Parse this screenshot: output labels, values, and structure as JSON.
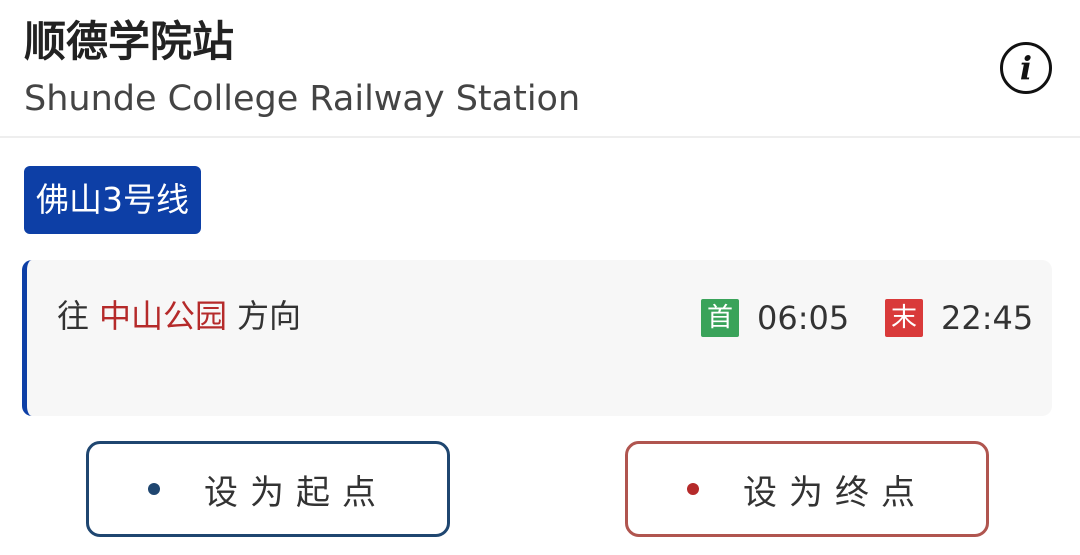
{
  "station": {
    "name_cn": "顺德学院站",
    "name_en": "Shunde College Railway Station",
    "info_icon": "i"
  },
  "line": {
    "name": "佛山3号线",
    "color": "#0d3fa6"
  },
  "direction": {
    "prefix": "往",
    "destination": "中山公园",
    "suffix": "方向",
    "first_tag": "首",
    "first_time": "06:05",
    "last_tag": "末",
    "last_time": "22:45"
  },
  "actions": {
    "set_start": "设为起点",
    "set_end": "设为终点"
  },
  "colors": {
    "accent_blue": "#0d3fa6",
    "destination_red": "#b52a2a",
    "first_green": "#3aa35a",
    "last_red": "#d93a3a"
  }
}
